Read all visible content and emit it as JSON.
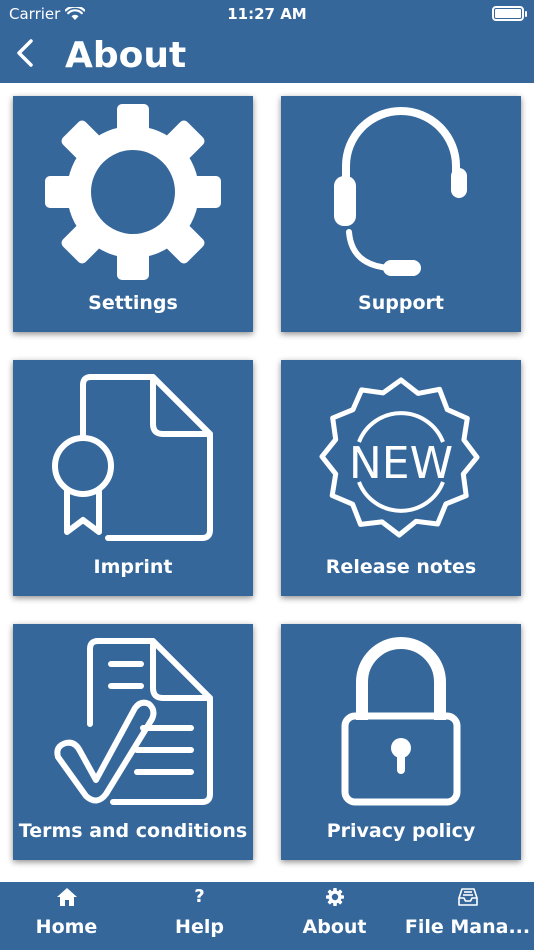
{
  "status_bar": {
    "carrier": "Carrier",
    "time": "11:27 AM"
  },
  "header": {
    "title": "About"
  },
  "tiles": [
    {
      "label": "Settings",
      "icon": "gear-icon"
    },
    {
      "label": "Support",
      "icon": "headset-icon"
    },
    {
      "label": "Imprint",
      "icon": "certificate-document-icon"
    },
    {
      "label": "Release notes",
      "icon": "new-badge-icon",
      "badge_text": "NEW"
    },
    {
      "label": "Terms and conditions",
      "icon": "checked-document-icon"
    },
    {
      "label": "Privacy policy",
      "icon": "padlock-icon"
    }
  ],
  "tab_bar": {
    "items": [
      {
        "label": "Home",
        "icon": "home-icon"
      },
      {
        "label": "Help",
        "icon": "help-icon",
        "glyph": "?"
      },
      {
        "label": "About",
        "icon": "gear-icon"
      },
      {
        "label": "File Mana...",
        "icon": "inbox-icon"
      }
    ]
  },
  "colors": {
    "primary": "#35679b",
    "background": "#ffffff",
    "foreground": "#ffffff"
  }
}
